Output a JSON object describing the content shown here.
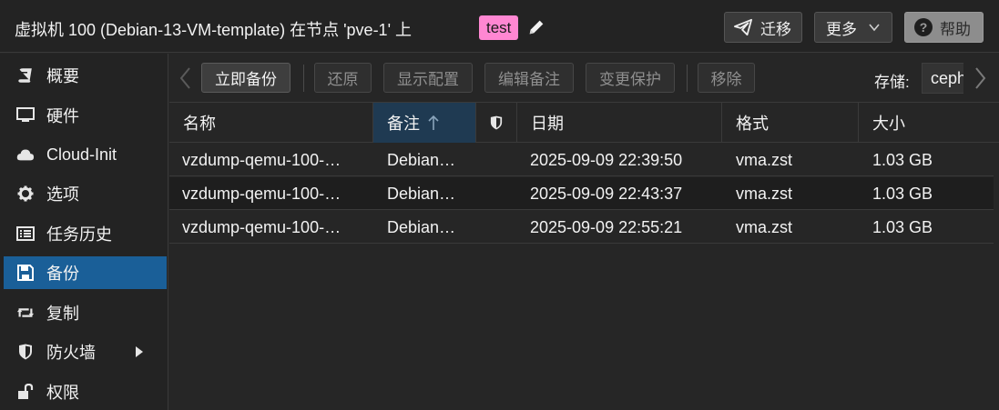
{
  "header": {
    "title": "虚拟机 100 (Debian-13-VM-template) 在节点 'pve-1' 上",
    "tag": "test",
    "migrate_label": "迁移",
    "more_label": "更多",
    "help_label": "帮助"
  },
  "sidebar": {
    "items": [
      {
        "label": "概要",
        "icon": "book-icon"
      },
      {
        "label": "硬件",
        "icon": "monitor-icon"
      },
      {
        "label": "Cloud-Init",
        "icon": "cloud-icon"
      },
      {
        "label": "选项",
        "icon": "gear-icon"
      },
      {
        "label": "任务历史",
        "icon": "list-icon"
      },
      {
        "label": "备份",
        "icon": "floppy-icon",
        "active": true
      },
      {
        "label": "复制",
        "icon": "retweet-icon"
      },
      {
        "label": "防火墙",
        "icon": "shield-icon",
        "expandable": true
      },
      {
        "label": "权限",
        "icon": "unlock-icon"
      }
    ]
  },
  "toolbar": {
    "backup_now": "立即备份",
    "restore": "还原",
    "show_config": "显示配置",
    "edit_notes": "编辑备注",
    "change_protection": "变更保护",
    "remove": "移除",
    "storage_label": "存储:",
    "storage_value": "ceph"
  },
  "grid": {
    "columns": {
      "name": "名称",
      "notes": "备注",
      "date": "日期",
      "format": "格式",
      "size": "大小"
    },
    "rows": [
      {
        "name": "vzdump-qemu-100-…",
        "notes": "Debian…",
        "date": "2025-09-09 22:39:50",
        "format": "vma.zst",
        "size": "1.03 GB"
      },
      {
        "name": "vzdump-qemu-100-…",
        "notes": "Debian…",
        "date": "2025-09-09 22:43:37",
        "format": "vma.zst",
        "size": "1.03 GB"
      },
      {
        "name": "vzdump-qemu-100-…",
        "notes": "Debian…",
        "date": "2025-09-09 22:55:21",
        "format": "vma.zst",
        "size": "1.03 GB"
      }
    ]
  },
  "colors": {
    "accent": "#1a5f98",
    "tag": "#ff87d2",
    "background": "#262626"
  }
}
